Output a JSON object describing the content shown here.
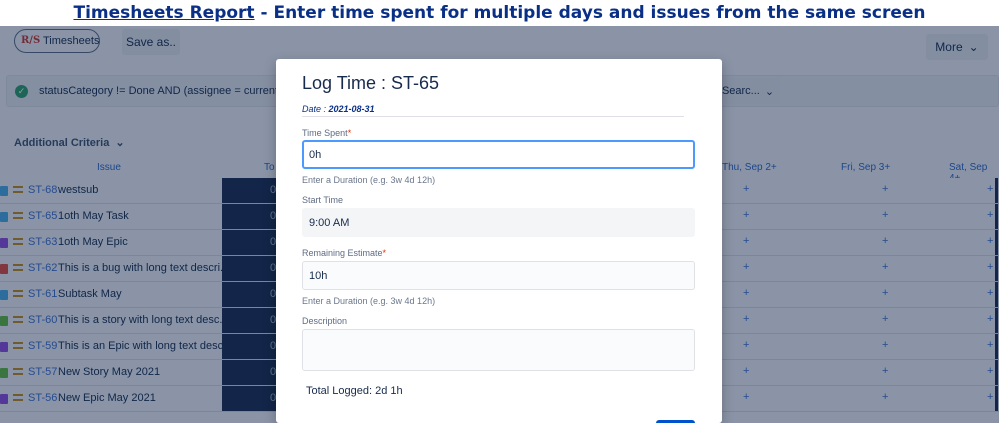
{
  "banner": {
    "link_text": "Timesheets Report",
    "rest_text": " - Enter time spent for multiple days and issues from the same screen"
  },
  "toolbar": {
    "timesheets_label": "Timesheets",
    "logo_text": "R/S",
    "save_label": "Save as..",
    "more_label": "More",
    "chevron_icon": "chevron-down-icon"
  },
  "filter": {
    "jql": "statusCategory != Done AND (assignee = currentUs",
    "search_label": "Searc...",
    "status_icon_color": "#2e9e69"
  },
  "criteria": {
    "label": "Additional Criteria"
  },
  "grid": {
    "headers": {
      "issue": "Issue",
      "total": "To",
      "thu": "Thu, Sep 2+",
      "fri": "Fri, Sep 3+",
      "sat": "Sat, Sep 4+"
    },
    "plus": "+",
    "rows": [
      {
        "key": "ST-68",
        "summary": "westsub",
        "type_color": "#4bade8",
        "total": "0"
      },
      {
        "key": "ST-65",
        "summary": "1oth May Task",
        "type_color": "#4bade8",
        "total": "0"
      },
      {
        "key": "ST-63",
        "summary": "1oth May Epic",
        "type_color": "#904ee2",
        "total": "0"
      },
      {
        "key": "ST-62",
        "summary": "This is a bug with long text descri...",
        "type_color": "#e5493a",
        "total": "0"
      },
      {
        "key": "ST-61",
        "summary": "Subtask May",
        "type_color": "#4bade8",
        "total": "0"
      },
      {
        "key": "ST-60",
        "summary": "This is a story with long text desc...",
        "type_color": "#63ba3c",
        "total": "0"
      },
      {
        "key": "ST-59",
        "summary": "This is an Epic with long text desc...",
        "type_color": "#904ee2",
        "total": "0"
      },
      {
        "key": "ST-57",
        "summary": "New Story May 2021",
        "type_color": "#63ba3c",
        "total": "0"
      },
      {
        "key": "ST-56",
        "summary": "New Epic May 2021",
        "type_color": "#904ee2",
        "total": "0"
      }
    ]
  },
  "modal": {
    "title": "Log Time : ST-65",
    "date_label": "Date : ",
    "date_value": "2021-08-31",
    "time_spent_label": "Time Spent",
    "time_spent_value": "0h",
    "duration_hint": "Enter a Duration (e.g. 3w 4d 12h)",
    "start_time_label": "Start Time",
    "start_time_value": "9:00 AM",
    "remaining_label": "Remaining Estimate",
    "remaining_value": "10h",
    "description_label": "Description",
    "description_value": "",
    "total_logged": "Total Logged: 2d 1h",
    "required_marker": "*"
  }
}
